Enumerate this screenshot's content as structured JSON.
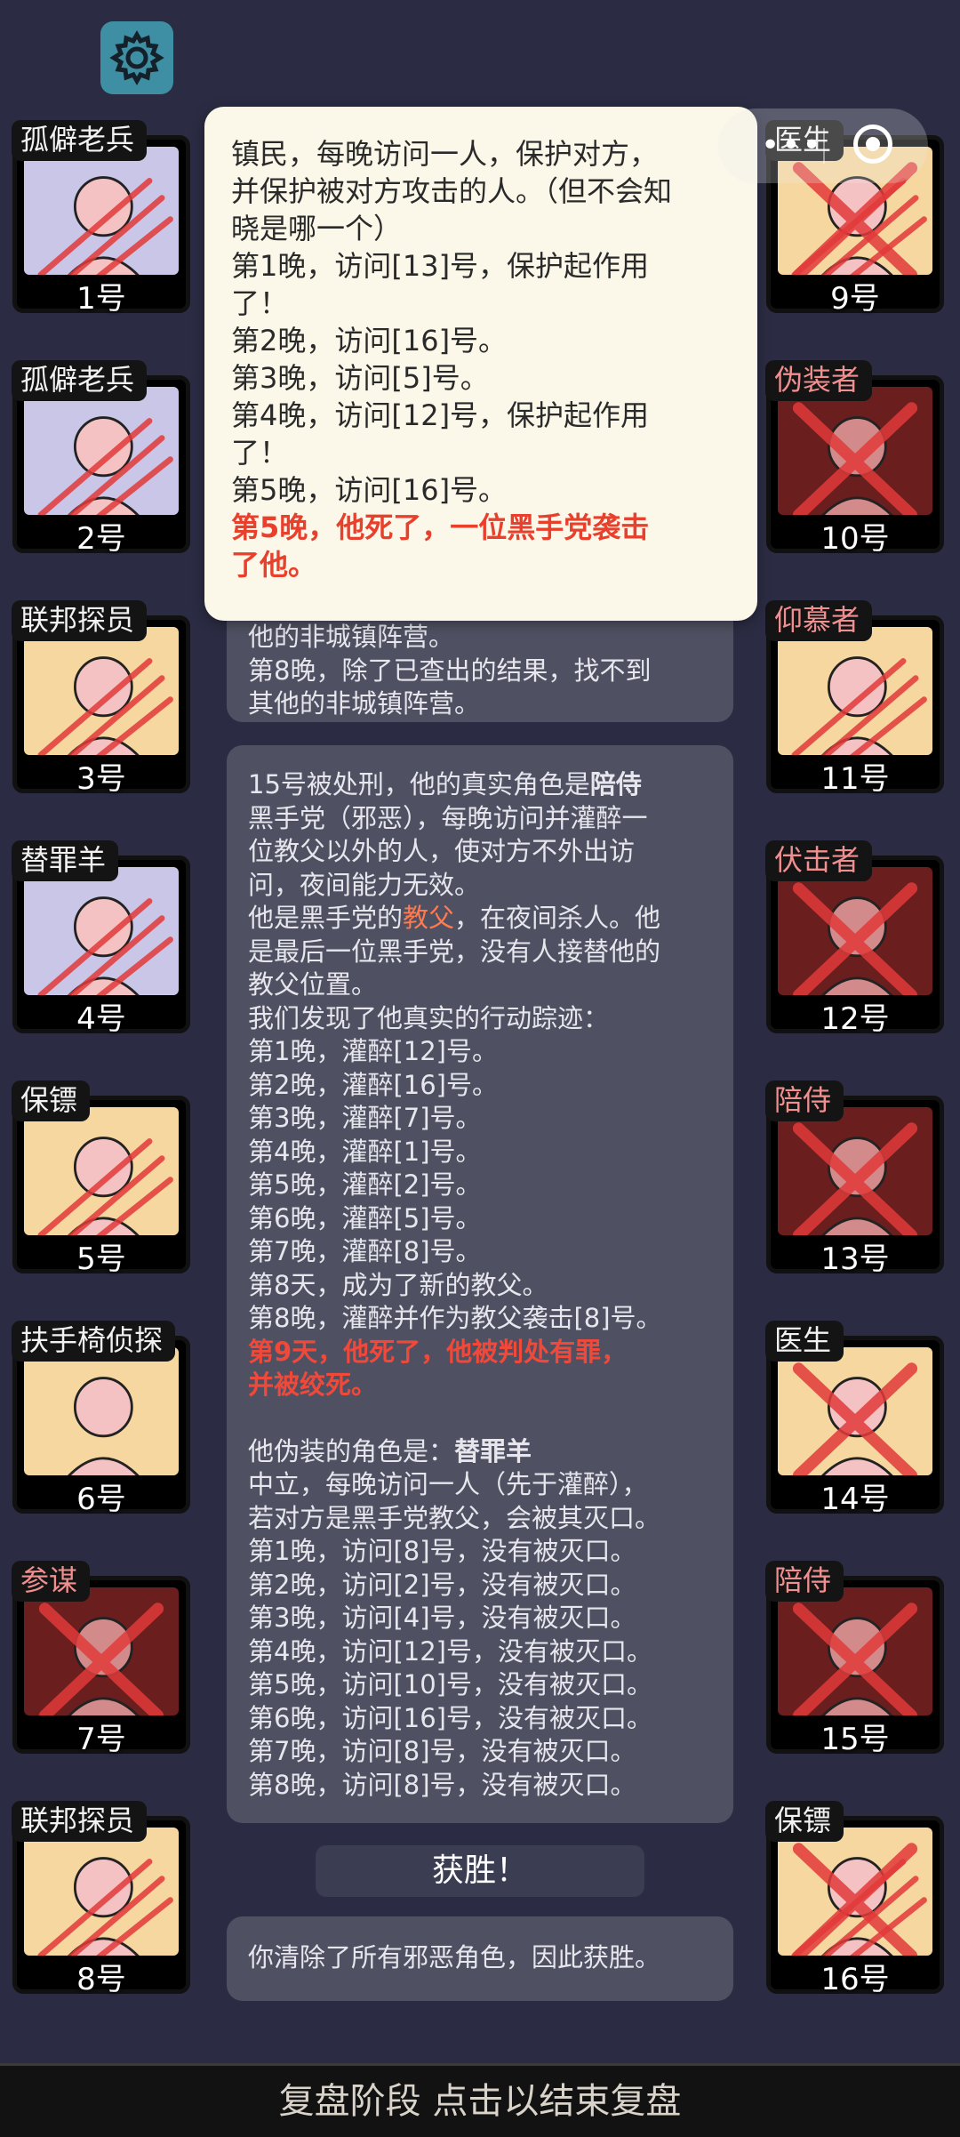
{
  "header": {
    "settings_icon": "gear-icon"
  },
  "capsule": {
    "more_label": "•••",
    "icon": "circle-target-icon"
  },
  "players_left": [
    {
      "role": "孤僻老兵",
      "num": "1号",
      "bg": "#c9c6e8",
      "evil": false,
      "dead": false,
      "scratch": true,
      "cross": false,
      "icon": "veteran-icon"
    },
    {
      "role": "孤僻老兵",
      "num": "2号",
      "bg": "#c9c6e8",
      "evil": false,
      "dead": false,
      "scratch": true,
      "cross": false,
      "icon": "veteran-icon"
    },
    {
      "role": "联邦探员",
      "num": "3号",
      "bg": "#f6d79f",
      "evil": false,
      "dead": false,
      "scratch": true,
      "cross": false,
      "icon": "fbi-badge-icon"
    },
    {
      "role": "替罪羊",
      "num": "4号",
      "bg": "#c9c6e8",
      "evil": false,
      "dead": false,
      "scratch": true,
      "cross": false,
      "icon": "ram-icon"
    },
    {
      "role": "保镖",
      "num": "5号",
      "bg": "#f6d79f",
      "evil": false,
      "dead": false,
      "scratch": true,
      "cross": false,
      "icon": "bodyguard-icon"
    },
    {
      "role": "扶手椅侦探",
      "num": "6号",
      "bg": "#f6d79f",
      "evil": false,
      "dead": false,
      "scratch": false,
      "cross": false,
      "icon": "armchair-icon"
    },
    {
      "role": "参谋",
      "num": "7号",
      "bg": "#6b1e1e",
      "evil": true,
      "dead": true,
      "scratch": false,
      "cross": true,
      "icon": "advisor-icon"
    },
    {
      "role": "联邦探员",
      "num": "8号",
      "bg": "#f6d79f",
      "evil": false,
      "dead": false,
      "scratch": true,
      "cross": false,
      "icon": "fbi-badge-icon"
    }
  ],
  "players_right": [
    {
      "role": "医生",
      "num": "9号",
      "bg": "#f6d79f",
      "evil": false,
      "dead": true,
      "scratch": true,
      "cross": true,
      "icon": "doctor-icon"
    },
    {
      "role": "伪装者",
      "num": "10号",
      "bg": "#6b1e1e",
      "evil": true,
      "dead": true,
      "scratch": false,
      "cross": true,
      "icon": "disguiser-icon"
    },
    {
      "role": "仰慕者",
      "num": "11号",
      "bg": "#f6d79f",
      "evil": true,
      "dead": false,
      "scratch": true,
      "cross": false,
      "icon": "admirer-icon"
    },
    {
      "role": "伏击者",
      "num": "12号",
      "bg": "#6b1e1e",
      "evil": true,
      "dead": true,
      "scratch": false,
      "cross": true,
      "icon": "ambusher-icon"
    },
    {
      "role": "陪侍",
      "num": "13号",
      "bg": "#6b1e1e",
      "evil": true,
      "dead": true,
      "scratch": false,
      "cross": true,
      "icon": "escort-icon"
    },
    {
      "role": "医生",
      "num": "14号",
      "bg": "#f6d79f",
      "evil": false,
      "dead": true,
      "scratch": false,
      "cross": true,
      "icon": "doctor-icon"
    },
    {
      "role": "陪侍",
      "num": "15号",
      "bg": "#6b1e1e",
      "evil": true,
      "dead": true,
      "scratch": false,
      "cross": true,
      "icon": "escort-icon"
    },
    {
      "role": "保镖",
      "num": "16号",
      "bg": "#f6d79f",
      "evil": false,
      "dead": true,
      "scratch": true,
      "cross": true,
      "icon": "bodyguard-icon"
    }
  ],
  "log_top": {
    "lines": [
      "他的非城镇阵营。",
      "第8晚，除了已查出的结果，找不到",
      "其他的非城镇阵营。"
    ]
  },
  "log_main": {
    "l1_a": "15号被处刑，他的真实角色是",
    "l1_b": "陪侍",
    "l2": "黑手党（邪恶），每晚访问并灌醉一",
    "l3": "位教父以外的人，使对方不外出访",
    "l4": "问，夜间能力无效。",
    "l5_a": "他是黑手党的",
    "l5_b": "教父",
    "l5_c": "，在夜间杀人。他",
    "l6": "是最后一位黑手党，没有人接替他的",
    "l7": "教父位置。",
    "l8": "我们发现了他真实的行动踪迹：",
    "nights": [
      "第1晚，灌醉[12]号。",
      "第2晚，灌醉[16]号。",
      "第3晚，灌醉[7]号。",
      "第4晚，灌醉[1]号。",
      "第5晚，灌醉[2]号。",
      "第6晚，灌醉[5]号。",
      "第7晚，灌醉[8]号。",
      "第8天，成为了新的教父。",
      "第8晚，灌醉并作为教父袭击[8]号。"
    ],
    "death1": "第9天，他死了，他被判处有罪，",
    "death2": "并被绞死。",
    "disguise_a": "他伪装的角色是：",
    "disguise_b": "替罪羊",
    "d1": "中立，每晚访问一人（先于灌醉），",
    "d2": "若对方是黑手党教父，会被其灭口。",
    "visits": [
      "第1晚，访问[8]号，没有被灭口。",
      "第2晚，访问[2]号，没有被灭口。",
      "第3晚，访问[4]号，没有被灭口。",
      "第4晚，访问[12]号，没有被灭口。",
      "第5晚，访问[10]号，没有被灭口。",
      "第6晚，访问[16]号，没有被灭口。",
      "第7晚，访问[8]号，没有被灭口。",
      "第8晚，访问[8]号，没有被灭口。"
    ]
  },
  "victory": {
    "label": "获胜！",
    "message": "你清除了所有邪恶角色，因此获胜。"
  },
  "tooltip": {
    "lines": [
      "镇民，每晚访问一人，保护对方，",
      "并保护被对方攻击的人。（但不会知",
      "晓是哪一个）",
      "第1晚，访问[13]号，保护起作用",
      "了！",
      "第2晚，访问[16]号。",
      "第3晚，访问[5]号。",
      "第4晚，访问[12]号，保护起作用",
      "了！",
      "第5晚，访问[16]号。"
    ],
    "death1": "第5晚，他死了，一位黑手党袭击",
    "death2": "了他。"
  },
  "footer": {
    "label": "复盘阶段 点击以结束复盘"
  },
  "colors": {
    "background": "#2b2c43",
    "panel": "#4f5163",
    "accent_red": "#f0493a",
    "role_orange": "#ff7a4e",
    "tooltip_bg": "#fbf8e9",
    "settings": "#3e8fa3"
  }
}
